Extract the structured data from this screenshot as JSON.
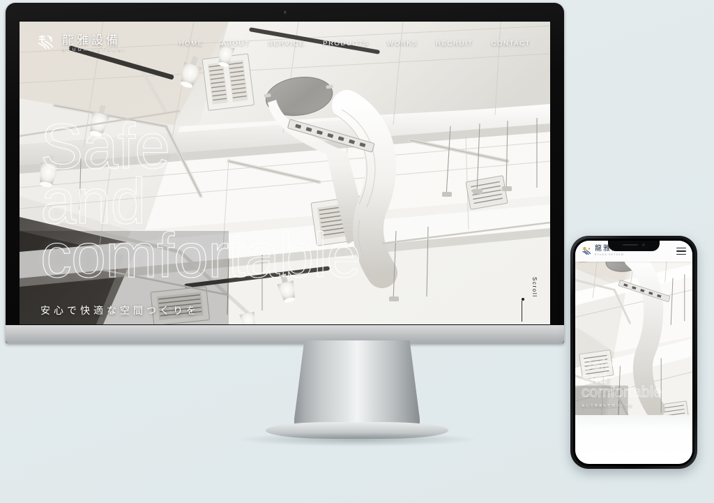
{
  "page": {
    "background_color": "#e3eaec",
    "description": "Responsive website mockup shown on a desktop monitor and a smartphone"
  },
  "site": {
    "brand": {
      "logo_icon": "ryuga-logo-mark",
      "name_jp": "龍雅設備",
      "name_en": "RYUGA SETSUBI",
      "mark_colors": {
        "gold": "#c8a33c",
        "blue": "#2a4a86",
        "white": "#ffffff"
      }
    },
    "nav": [
      {
        "label": "HOME",
        "id": "home"
      },
      {
        "label": "ABOUT",
        "id": "about"
      },
      {
        "label": "SERVICE",
        "id": "service"
      },
      {
        "label": "PRODUCTS",
        "id": "products"
      },
      {
        "label": "WORKS",
        "id": "works"
      },
      {
        "label": "RECRUIT",
        "id": "recruit"
      },
      {
        "label": "CONTACT",
        "id": "contact"
      }
    ],
    "hero": {
      "line1": "Safe",
      "line2": "and",
      "line3": "comfortable",
      "tagline_jp": "安心で快適な空間つくりを",
      "text_color": "#ffffff",
      "style": "outlined"
    },
    "scroll_indicator": {
      "label": "Scroll",
      "icon": "scroll-down-line"
    },
    "mobile": {
      "menu_icon": "hamburger-menu-icon"
    }
  },
  "devices": {
    "desktop": {
      "name": "desktop-monitor",
      "webcam_icon": "webcam-dot"
    },
    "phone": {
      "name": "smartphone",
      "notch_icons": [
        "earpiece-speaker",
        "front-camera"
      ]
    }
  }
}
